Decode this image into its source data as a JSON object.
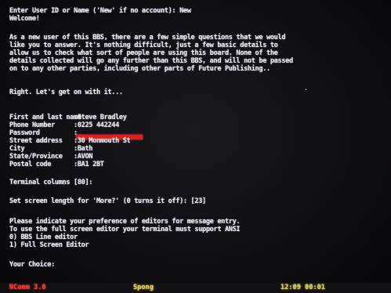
{
  "terminal": {
    "prompt_line": "Enter User ID or Name ('New' if no account): New",
    "welcome": "Welcome!",
    "intro": [
      "As a new user of this BBS, there are a few simple questions that we would",
      "like you to answer. It's nothing difficult, just a few basic details to",
      "allow us to check what sort of people are using this board. None of the",
      "details collected will go any further than this BBS, and will not be passed",
      "on to any other parties, including other parts of Future Publishing.."
    ],
    "get_on": "Right. Let's get on with it...",
    "form": [
      {
        "label": "First and last name",
        "value": "Steve Bradley"
      },
      {
        "label": "Phone Number",
        "value": "0225 442244"
      },
      {
        "label": "Password",
        "value": ""
      },
      {
        "label": "Street address",
        "value": "30 Monmouth St"
      },
      {
        "label": "City",
        "value": "Bath"
      },
      {
        "label": "State/Province",
        "value": "AVON"
      },
      {
        "label": "Postal code",
        "value": "BA1 2BT"
      }
    ],
    "terminal_columns": "Terminal columns [80]:",
    "screen_length": "Set screen length for 'More?' (0 turns it off): [23]",
    "editor_prompt": [
      "Please indicate your preference of editors for message entry.",
      "To use the full screen editor your terminal must support ANSI",
      "0) BBS Line editor",
      "1) Full Screen Editor"
    ],
    "your_choice": "Your Choice:"
  },
  "status_bar": {
    "left": "NComm 3.0",
    "middle": "Spong",
    "right": "12:09 00:01"
  },
  "colors": {
    "text": "#e9e9ef",
    "password_mask": "#e01e1e",
    "status_left": "#ff3b2f",
    "status_other": "#e7d35a"
  }
}
